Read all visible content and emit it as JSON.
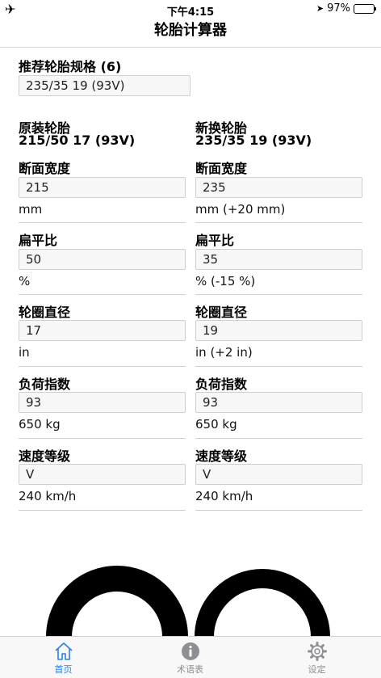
{
  "status": {
    "airplane_icon": "airplane-icon",
    "time": "下午4:15",
    "battery_text": "97%",
    "battery_level": 0.97
  },
  "nav": {
    "title": "轮胎计算器"
  },
  "recommended": {
    "label": "推荐轮胎规格 (6)",
    "value": "235/35 19 (93V)"
  },
  "original": {
    "title": "原装轮胎",
    "size": "215/50 17 (93V)",
    "fields": [
      {
        "label": "断面宽度",
        "value": "215",
        "unit": "mm"
      },
      {
        "label": "扁平比",
        "value": "50",
        "unit": "%"
      },
      {
        "label": "轮圈直径",
        "value": "17",
        "unit": "in"
      },
      {
        "label": "负荷指数",
        "value": "93",
        "unit": "650 kg"
      },
      {
        "label": "速度等级",
        "value": "V",
        "unit": "240 km/h"
      }
    ]
  },
  "replacement": {
    "title": "新换轮胎",
    "size": "235/35 19 (93V)",
    "fields": [
      {
        "label": "断面宽度",
        "value": "235",
        "unit": "mm (+20 mm)"
      },
      {
        "label": "扁平比",
        "value": "35",
        "unit": "% (-15 %)"
      },
      {
        "label": "轮圈直径",
        "value": "19",
        "unit": "in (+2 in)"
      },
      {
        "label": "负荷指数",
        "value": "93",
        "unit": "650 kg"
      },
      {
        "label": "速度等级",
        "value": "V",
        "unit": "240 km/h"
      }
    ]
  },
  "tabs": [
    {
      "label": "首页",
      "icon": "home-icon",
      "active": true
    },
    {
      "label": "术语表",
      "icon": "info-icon",
      "active": false
    },
    {
      "label": "设定",
      "icon": "gear-icon",
      "active": false
    }
  ],
  "colors": {
    "accent": "#2b7de9",
    "inactive": "#8e8e93"
  }
}
